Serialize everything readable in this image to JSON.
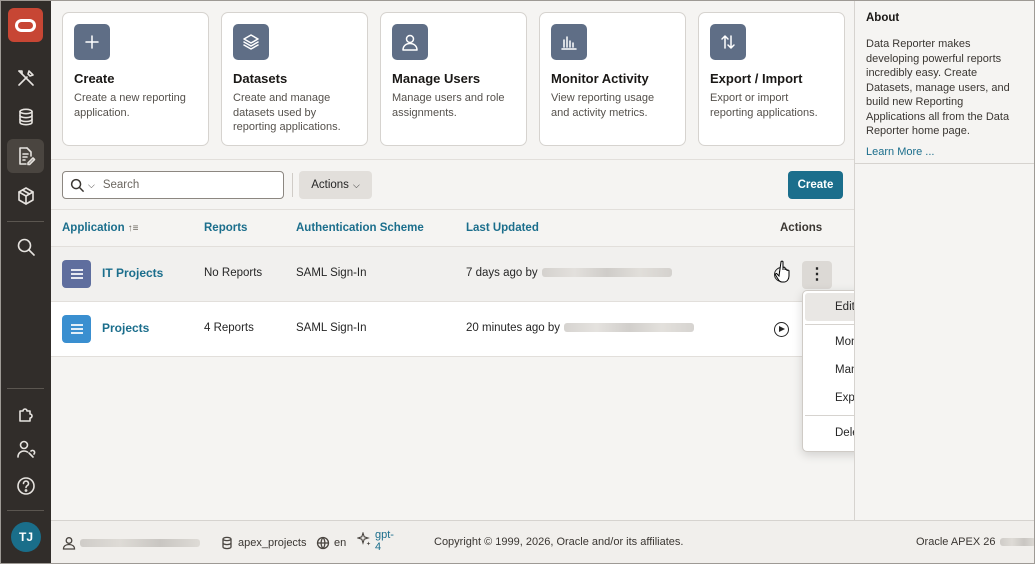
{
  "nav": {
    "user_initials": "TJ"
  },
  "cards": [
    {
      "title": "Create",
      "desc": "Create a new reporting application.",
      "icon": "plus-icon"
    },
    {
      "title": "Datasets",
      "desc": "Create and manage datasets used by reporting applications.",
      "icon": "layers-icon"
    },
    {
      "title": "Manage Users",
      "desc": "Manage users and role assignments.",
      "icon": "user-icon"
    },
    {
      "title": "Monitor Activity",
      "desc": "View reporting usage and activity metrics.",
      "icon": "chart-icon"
    },
    {
      "title": "Export / Import",
      "desc": "Export or import reporting applications.",
      "icon": "arrows-icon"
    }
  ],
  "toolbar": {
    "search_placeholder": "Search",
    "actions_label": "Actions",
    "create_label": "Create"
  },
  "table": {
    "columns": {
      "application": "Application",
      "reports": "Reports",
      "auth": "Authentication Scheme",
      "updated": "Last Updated",
      "actions": "Actions"
    },
    "rows": [
      {
        "name": "IT Projects",
        "reports": "No Reports",
        "auth": "SAML Sign-In",
        "updated": "7 days ago by",
        "icon_color": "#5f6e9e"
      },
      {
        "name": "Projects",
        "reports": "4 Reports",
        "auth": "SAML Sign-In",
        "updated": "20 minutes ago by",
        "icon_color": "#3a8fd0"
      }
    ]
  },
  "menu": {
    "items": [
      "Edit",
      "Monitor Activity",
      "Manage Users",
      "Export",
      "Delete"
    ]
  },
  "about": {
    "title": "About",
    "text": "Data Reporter makes developing powerful reports incredibly easy. Create Datasets, manage users, and build new Reporting Applications all from the Data Reporter home page.",
    "link": "Learn More ..."
  },
  "footer": {
    "schema": "apex_projects",
    "language": "en",
    "ai_model_line1": "gpt-",
    "ai_model_line2": "4",
    "copyright": "Copyright © 1999, 2026, Oracle and/or its affiliates.",
    "version": "Oracle APEX 26"
  },
  "colors": {
    "brand_red": "#c74634",
    "accent": "#1b6e8c",
    "rail": "#312d2a"
  }
}
